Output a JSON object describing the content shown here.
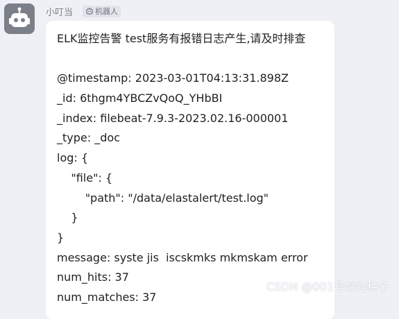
{
  "sender": {
    "name": "小叮当",
    "badge_label": "机器人",
    "avatar_icon": "robot-icon",
    "badge_icon": "robot-icon"
  },
  "message": {
    "title": "ELK监控告警 test服务有报错日志产生,请及时排查",
    "lines": [
      "@timestamp: 2023-03-01T04:13:31.898Z",
      "_id: 6thgm4YBCZvQoQ_YHbBI",
      "_index: filebeat-7.9.3-2023.02.16-000001",
      "_type: _doc",
      "log: {",
      "    \"file\": {",
      "        \"path\": \"/data/elastalert/test.log\"",
      "    }",
      "}",
      "message: syste jis  iscskmks mkmskam error",
      "num_hits: 37",
      "num_matches: 37"
    ]
  },
  "watermark": "CSDN @001号妙蛙种子",
  "colors": {
    "page_background": "#eef0f5",
    "bubble_background": "#ffffff",
    "avatar_background": "#7b7f88",
    "secondary_text": "#7d818a"
  }
}
